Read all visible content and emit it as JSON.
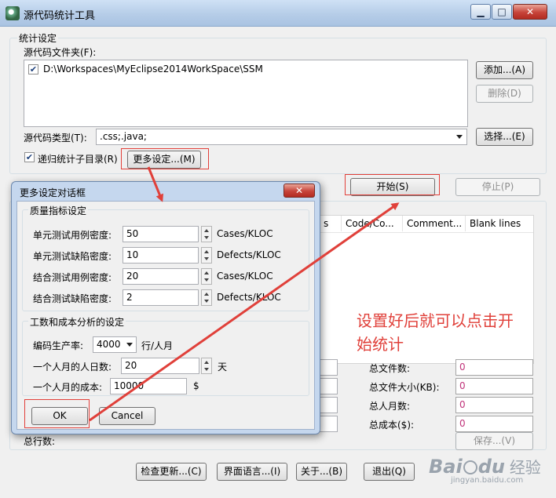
{
  "window": {
    "title": "源代码统计工具",
    "minimize": "▁",
    "maximize": "□",
    "close": "✕"
  },
  "stats_settings": {
    "group_label": "统计设定",
    "folder_label": "源代码文件夹(F):",
    "folders": [
      {
        "path": "D:\\Workspaces\\MyEclipse2014WorkSpace\\SSM",
        "checked": true
      }
    ],
    "add_button": "添加...(A)",
    "delete_button": "删除(D)",
    "type_label": "源代码类型(T):",
    "type_value": ".css;.java;",
    "select_button": "选择...(E)",
    "recursive_label": "递归统计子目录(R)",
    "recursive_checked": true,
    "more_settings_button": "更多设定...(M)"
  },
  "actions": {
    "start_button": "开始(S)",
    "stop_button": "停止(P)"
  },
  "results": {
    "columns": [
      "s",
      "Code/Co...",
      "Comment...",
      "Blank lines"
    ],
    "summary": [
      {
        "label": "总文件数:",
        "value": "0"
      },
      {
        "label": "总文件大小(KB):",
        "value": "0"
      },
      {
        "label": "总人月数:",
        "value": "0"
      },
      {
        "label": "总成本($):",
        "value": "0"
      }
    ],
    "total_lines_label": "总行数:",
    "save_button": "保存...(V)"
  },
  "footer": {
    "check_update": "检查更新...(C)",
    "language": "界面语言...(I)",
    "about": "关于...(B)",
    "exit": "退出(Q)"
  },
  "dialog": {
    "title": "更多设定对话框",
    "close": "✕",
    "quality_group": "质量指标设定",
    "quality_rows": [
      {
        "label": "单元测试用例密度:",
        "value": "50",
        "unit": "Cases/KLOC"
      },
      {
        "label": "单元测试缺陷密度:",
        "value": "10",
        "unit": "Defects/KLOC"
      },
      {
        "label": "结合测试用例密度:",
        "value": "20",
        "unit": "Cases/KLOC"
      },
      {
        "label": "结合测试缺陷密度:",
        "value": "2",
        "unit": "Defects/KLOC"
      }
    ],
    "cost_group": "工数和成本分析的设定",
    "productivity_label": "编码生产率:",
    "productivity_value": "4000",
    "productivity_unit": "行/人月",
    "days_label": "一个人月的人日数:",
    "days_value": "20",
    "days_unit": "天",
    "cost_label": "一个人月的成本:",
    "cost_value": "10000",
    "cost_unit": "$",
    "ok_button": "OK",
    "cancel_button": "Cancel"
  },
  "annotation": {
    "line1": "设置好后就可以点击开",
    "line2": "始统计"
  },
  "watermark": {
    "brand": "Bai",
    "brand_suffix": "du",
    "tag": "经验",
    "url": "jingyan.baidu.com"
  },
  "colors": {
    "annotation_red": "#e0403a",
    "summary_value_color": "#c0337a"
  }
}
